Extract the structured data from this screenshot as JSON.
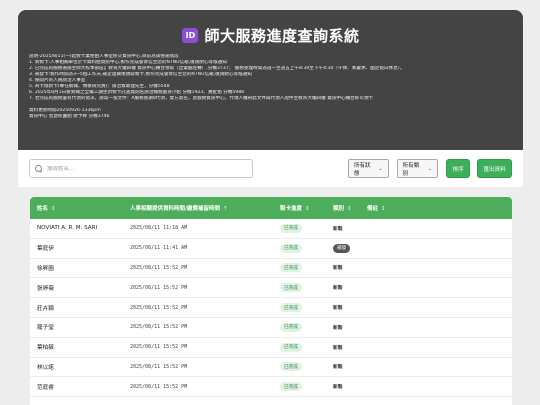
{
  "header": {
    "icon_name": "id-badge-icon",
    "icon_text": "ID",
    "title": "師大服務進度查詢系統",
    "notice_lines": [
      "說明-2025/8/11(一)起製卡業務由人事室移交資訊中心,目前為試營運階段",
      "1. 新製卡:人事相關單位於卡資料給資訊中心,製作完成會寄信至您的NTNU信箱,敬請耐心等候通知",
      "2. 已完成的服務選請至師大校本部區】教育大樓四樓 資訊中心櫃台領取（出電腦左轉）,分機3737； 服務受理時間為週一至週五上午8:30至下午4:30（午休、寒暑休、國定假日休息）。",
      "3. 補發卡:製作時間為3~5個工作天,補定遺費後親取製卡,製作完成會寄信至您的NTNU信箱,敬請耐心等候通知",
      "4. 秘間片的人員請洽人事室",
      "5. 商卡換新卡(專任助職、博後研究員)：請洽資助理先生，分機5548",
      "6. 2025年8月1日後到職之全職工讀生新製卡託查無則名請洽總務處孫小姐 分機1923、黃祉佑 分機5988",
      "7. 若完成的服務還有代領的需求，請寫一張文件：A服務感謝8代領，雙方簽名，此服務資訊中心，代領人攜帶此文件與代領人證件至教育大樓四樓 資訊中心櫃台即可領卡",
      "",
      "資料更新時間20250926-1336pm",
      "資訊中心 智慧校園組 廖予婷 分機3746"
    ]
  },
  "toolbar": {
    "search_placeholder": "搜尋姓名...",
    "status_select": "所有狀態",
    "category_select": "所有類別",
    "sort_label": "排序",
    "export_label": "匯出資料"
  },
  "table": {
    "headers": {
      "name": "姓名",
      "time": "人事相關提供資料時間/繳費補留時間",
      "progress": "製卡進度",
      "category": "類別",
      "note": "備註"
    },
    "rows": [
      {
        "name": "NOVIATI A. R. M. SARI",
        "time": "2025/08/11 11:18 AM",
        "progress": "已完成",
        "category": "新製",
        "cat_style": "new"
      },
      {
        "name": "葉庭伊",
        "time": "2025/08/11 11:41 AM",
        "progress": "已完成",
        "category": "補發",
        "cat_style": "renew"
      },
      {
        "name": "徐昇圓",
        "time": "2025/08/11 15:52 PM",
        "progress": "已完成",
        "category": "新製",
        "cat_style": "new"
      },
      {
        "name": "張婷薇",
        "time": "2025/08/11 15:52 PM",
        "progress": "已完成",
        "category": "新製",
        "cat_style": "new"
      },
      {
        "name": "莊卉穎",
        "time": "2025/08/11 15:52 PM",
        "progress": "已完成",
        "category": "新製",
        "cat_style": "new"
      },
      {
        "name": "籠子瑩",
        "time": "2025/08/11 15:52 PM",
        "progress": "已完成",
        "category": "新製",
        "cat_style": "new"
      },
      {
        "name": "葉柏毓",
        "time": "2025/08/11 15:52 PM",
        "progress": "已完成",
        "category": "新製",
        "cat_style": "new"
      },
      {
        "name": "林以諾",
        "time": "2025/08/11 15:52 PM",
        "progress": "已完成",
        "category": "新製",
        "cat_style": "new"
      },
      {
        "name": "范庭睿",
        "time": "2025/08/11 15:52 PM",
        "progress": "已完成",
        "category": "新製",
        "cat_style": "new"
      }
    ]
  },
  "colors": {
    "header_bg": "#444444",
    "accent_green": "#4cae5b",
    "button_green": "#3daf5a",
    "badge_purple": "#8a4fd3"
  }
}
